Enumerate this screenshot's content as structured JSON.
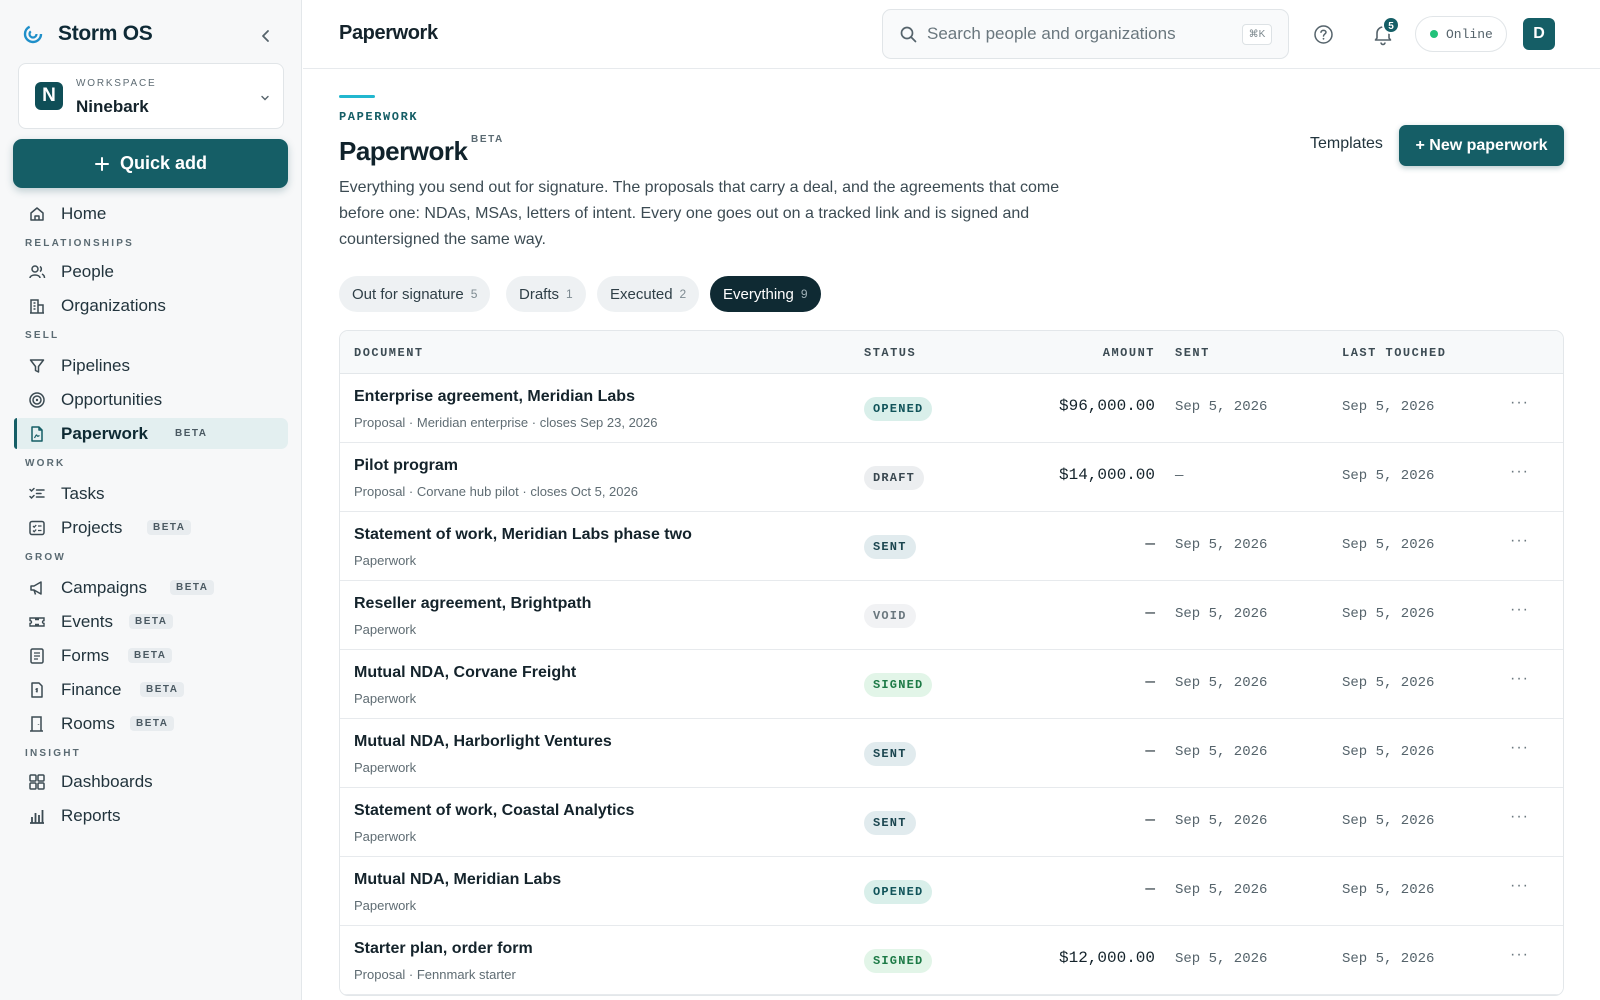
{
  "app": {
    "name": "Storm OS"
  },
  "workspace": {
    "label": "WORKSPACE",
    "name": "Ninebark",
    "logo_letter": "N"
  },
  "quick_add": {
    "label": "Quick add"
  },
  "nav": {
    "home": "Home",
    "sections": {
      "relationships": "RELATIONSHIPS",
      "sell": "SELL",
      "work": "WORK",
      "grow": "GROW",
      "insight": "INSIGHT"
    },
    "people": "People",
    "organizations": "Organizations",
    "pipelines": "Pipelines",
    "opportunities": "Opportunities",
    "paperwork": "Paperwork",
    "tasks": "Tasks",
    "projects": "Projects",
    "campaigns": "Campaigns",
    "events": "Events",
    "forms": "Forms",
    "finance": "Finance",
    "rooms": "Rooms",
    "dashboards": "Dashboards",
    "reports": "Reports",
    "beta": "BETA"
  },
  "topbar": {
    "title": "Paperwork",
    "search_placeholder": "Search people and organizations",
    "shortcut": "⌘K",
    "notification_count": "5",
    "status": "Online",
    "avatar_letter": "D"
  },
  "page": {
    "eyebrow": "PAPERWORK",
    "title": "Paperwork",
    "title_badge": "BETA",
    "description": "Everything you send out for signature. The proposals that carry a deal, and the agreements that come before one: NDAs, MSAs, letters of intent. Every one goes out on a tracked link and is signed and countersigned the same way.",
    "templates_label": "Templates",
    "new_label": "+ New paperwork"
  },
  "tabs": [
    {
      "label": "Out for signature",
      "count": "5"
    },
    {
      "label": "Drafts",
      "count": "1"
    },
    {
      "label": "Executed",
      "count": "2"
    },
    {
      "label": "Everything",
      "count": "9"
    }
  ],
  "table": {
    "headers": {
      "document": "DOCUMENT",
      "status": "STATUS",
      "amount": "AMOUNT",
      "sent": "SENT",
      "last_touched": "LAST TOUCHED"
    },
    "rows": [
      {
        "title": "Enterprise agreement, Meridian Labs",
        "sub": "Proposal · Meridian enterprise · closes Sep 23, 2026",
        "status": "OPENED",
        "amount": "$96,000.00",
        "sent": "Sep 5, 2026",
        "touched": "Sep 5, 2026",
        "more": "···"
      },
      {
        "title": "Pilot program",
        "sub": "Proposal · Corvane hub pilot · closes Oct 5, 2026",
        "status": "DRAFT",
        "amount": "$14,000.00",
        "sent": "—",
        "touched": "Sep 5, 2026",
        "more": "···"
      },
      {
        "title": "Statement of work, Meridian Labs phase two",
        "sub": "Paperwork",
        "status": "SENT",
        "amount": "—",
        "sent": "Sep 5, 2026",
        "touched": "Sep 5, 2026",
        "more": "···"
      },
      {
        "title": "Reseller agreement, Brightpath",
        "sub": "Paperwork",
        "status": "VOID",
        "amount": "—",
        "sent": "Sep 5, 2026",
        "touched": "Sep 5, 2026",
        "more": "···"
      },
      {
        "title": "Mutual NDA, Corvane Freight",
        "sub": "Paperwork",
        "status": "SIGNED",
        "amount": "—",
        "sent": "Sep 5, 2026",
        "touched": "Sep 5, 2026",
        "more": "···"
      },
      {
        "title": "Mutual NDA, Harborlight Ventures",
        "sub": "Paperwork",
        "status": "SENT",
        "amount": "—",
        "sent": "Sep 5, 2026",
        "touched": "Sep 5, 2026",
        "more": "···"
      },
      {
        "title": "Statement of work, Coastal Analytics",
        "sub": "Paperwork",
        "status": "SENT",
        "amount": "—",
        "sent": "Sep 5, 2026",
        "touched": "Sep 5, 2026",
        "more": "···"
      },
      {
        "title": "Mutual NDA, Meridian Labs",
        "sub": "Paperwork",
        "status": "OPENED",
        "amount": "—",
        "sent": "Sep 5, 2026",
        "touched": "Sep 5, 2026",
        "more": "···"
      },
      {
        "title": "Starter plan, order form",
        "sub": "Proposal · Fennmark starter",
        "status": "SIGNED",
        "amount": "$12,000.00",
        "sent": "Sep 5, 2026",
        "touched": "Sep 5, 2026",
        "more": "···"
      }
    ]
  },
  "colors": {
    "brand": "#155e66",
    "accent": "#22b7cf",
    "status_opened": "#dcefeb",
    "status_draft": "#eceef0",
    "status_sent": "#e3ecef",
    "status_void": "#f1f2f4",
    "status_signed": "#e3f6ea"
  }
}
